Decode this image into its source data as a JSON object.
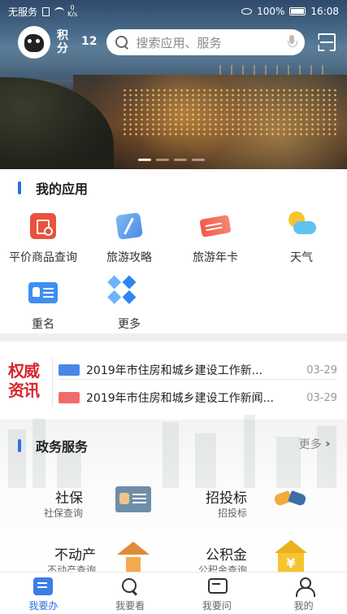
{
  "status_bar": {
    "carrier": "无服务",
    "net_speed_value": "0",
    "net_speed_unit": "K/s",
    "battery": "100%",
    "time": "16:08"
  },
  "header": {
    "points_label": "积分",
    "points_value": "12",
    "search_placeholder": "搜索应用、服务"
  },
  "banner": {
    "slide_count": 4,
    "active_slide": 1
  },
  "my_apps": {
    "title": "我的应用",
    "items": [
      {
        "label": "平价商品查询",
        "icon": "price-query-icon"
      },
      {
        "label": "旅游攻略",
        "icon": "travel-guide-icon"
      },
      {
        "label": "旅游年卡",
        "icon": "travel-card-icon"
      },
      {
        "label": "天气",
        "icon": "weather-icon"
      },
      {
        "label": "重名",
        "icon": "name-duplicate-icon"
      },
      {
        "label": "更多",
        "icon": "more-apps-icon"
      }
    ]
  },
  "news": {
    "logo_line1": "权威",
    "logo_line2": "资讯",
    "items": [
      {
        "title": "2019年市住房和城乡建设工作新...",
        "date": "03-29",
        "tag_color": "#4a86e8"
      },
      {
        "title": "2019年市住房和城乡建设工作新闻...",
        "date": "03-29",
        "tag_color": "#f06b6b"
      }
    ]
  },
  "gov_services": {
    "title": "政务服务",
    "more_label": "更多",
    "items": [
      {
        "title": "社保",
        "subtitle": "社保查询",
        "icon": "social-security-card-icon"
      },
      {
        "title": "招投标",
        "subtitle": "招投标",
        "icon": "handshake-icon"
      },
      {
        "title": "不动产",
        "subtitle": "不动产查询",
        "icon": "house-icon"
      },
      {
        "title": "公积金",
        "subtitle": "公积金查询",
        "icon": "housing-fund-icon"
      }
    ]
  },
  "tabbar": {
    "tabs": [
      {
        "label": "我要办",
        "icon": "doc-icon",
        "active": true
      },
      {
        "label": "我要看",
        "icon": "search-view-icon",
        "active": false
      },
      {
        "label": "我要问",
        "icon": "chat-icon",
        "active": false
      },
      {
        "label": "我的",
        "icon": "user-icon",
        "active": false
      }
    ]
  },
  "colors": {
    "accent": "#2f6ee0",
    "news_logo": "#d8262d"
  }
}
